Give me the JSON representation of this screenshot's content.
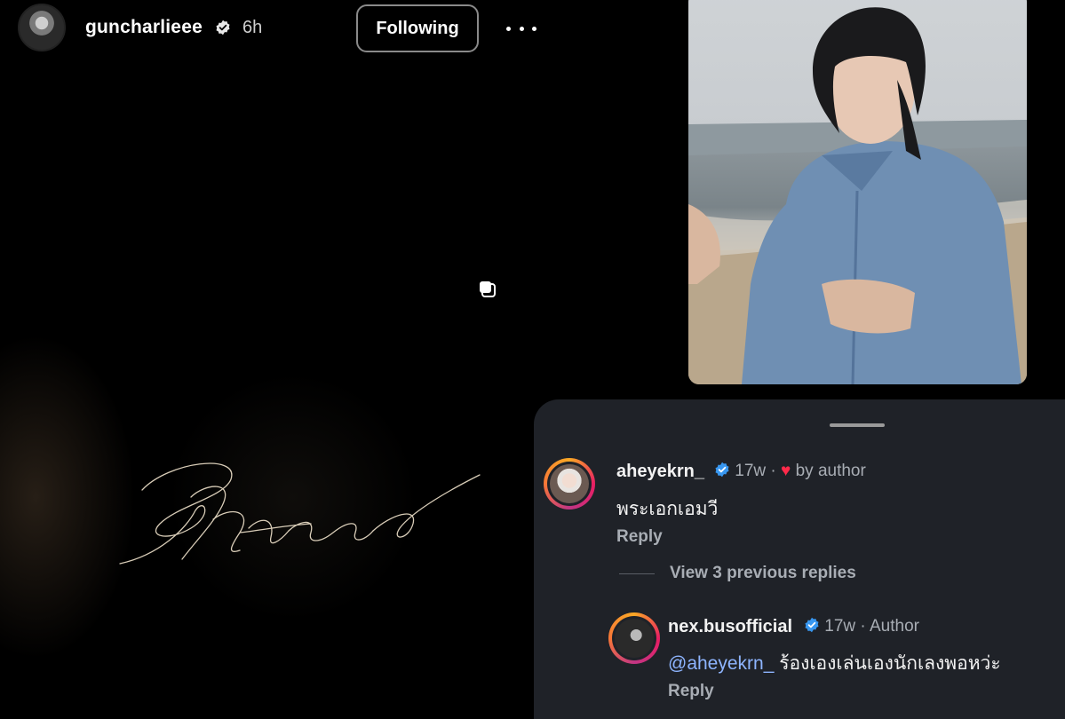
{
  "post": {
    "username": "guncharlieee",
    "time": "6h",
    "follow_label": "Following"
  },
  "colors": {
    "verified": "#3897f0",
    "mention": "#8eb5ff",
    "heart": "#ff2a4a",
    "sheet": "#1f2228"
  },
  "comments": {
    "first": {
      "username": "aheyekrn_",
      "time": "17w",
      "separator": "·",
      "liked_label": "by author",
      "text": "พระเอกเอมวี",
      "reply_label": "Reply"
    },
    "view_previous": "View 3 previous replies",
    "second": {
      "username": "nex.busofficial",
      "time": "17w",
      "separator": "·",
      "role": "Author",
      "mention": "@aheyekrn_",
      "text": "ร้องเองเล่นเองนักเลงพอหว่ะ",
      "reply_label": "Reply"
    }
  },
  "icons": {
    "verified": "verified-badge-icon",
    "more": "more-horizontal-icon",
    "carousel": "carousel-icon",
    "heart": "heart-icon"
  }
}
